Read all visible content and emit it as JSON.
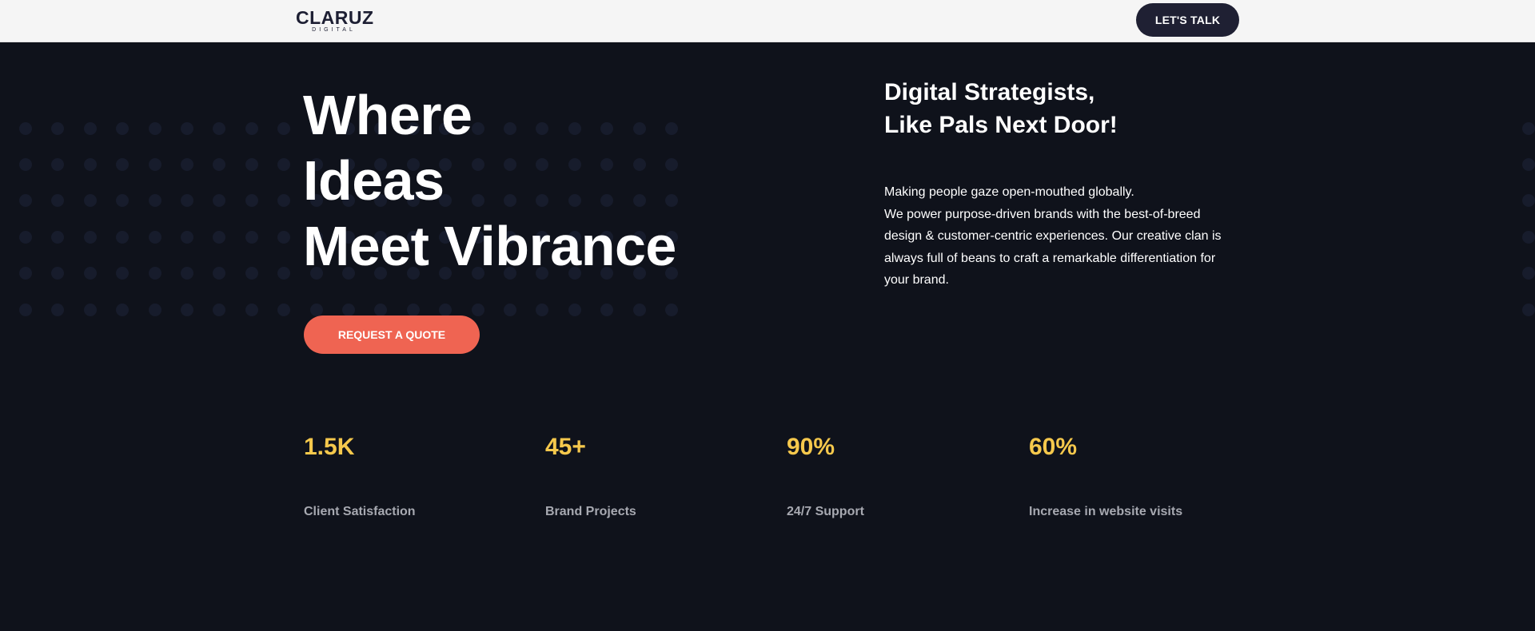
{
  "header": {
    "logo_name": "CLARUZ",
    "logo_sub": "DIGITAL",
    "cta_label": "LET'S TALK"
  },
  "hero": {
    "headline": [
      "Where",
      "Ideas",
      "Meet Vibrance"
    ],
    "cta_label": "REQUEST A QUOTE",
    "tagline": [
      "Digital Strategists,",
      "Like Pals Next Door!"
    ],
    "description": [
      "Making people gaze open-mouthed globally.",
      "We power purpose-driven brands with the best-of-breed design & customer-centric experiences. Our creative clan is always full of beans to craft a remarkable differentiation for your brand."
    ]
  },
  "stats": [
    {
      "value": "1.5K",
      "label": "Client Satisfaction"
    },
    {
      "value": "45+",
      "label": "Brand Projects"
    },
    {
      "value": "90%",
      "label": "24/7 Support"
    },
    {
      "value": "60%",
      "label": "Increase in website visits"
    }
  ],
  "colors": {
    "background": "#0f121b",
    "header_bg": "#f5f5f5",
    "accent_coral": "#ef6452",
    "stat_yellow": "#f5c84c",
    "dark_button": "#1f2033"
  }
}
